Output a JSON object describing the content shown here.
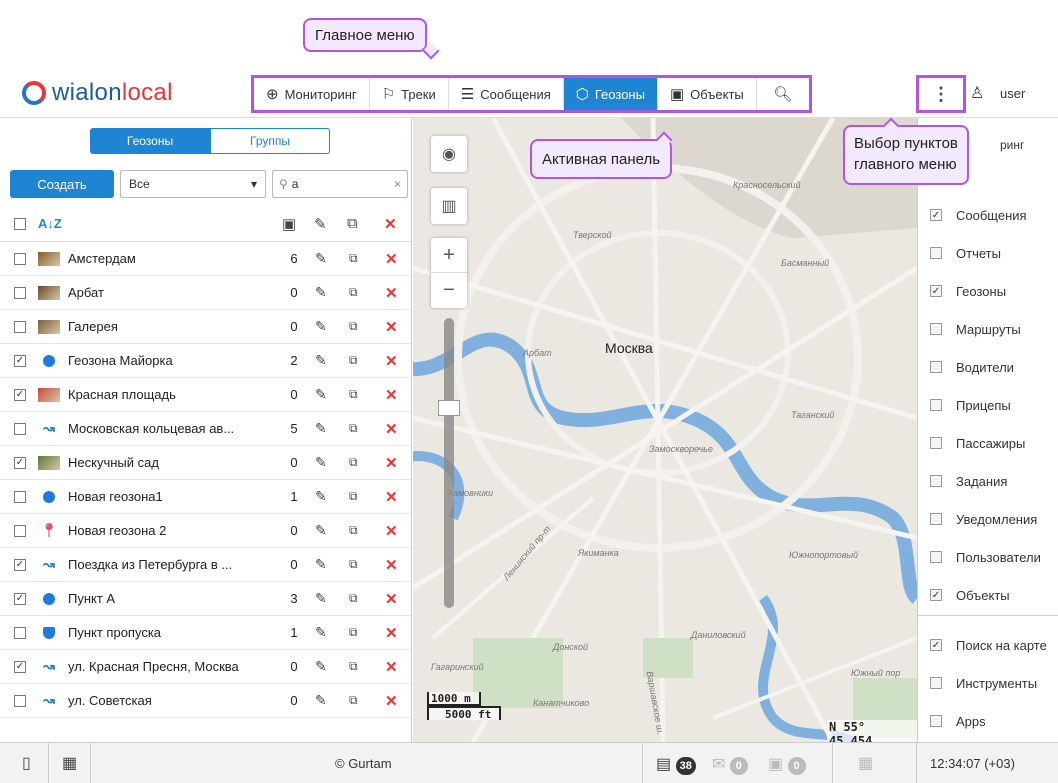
{
  "callouts": {
    "main_menu": "Главное меню",
    "active_panel": "Активная панель",
    "select_items_line1": "Выбор пунктов",
    "select_items_line2": "главного меню"
  },
  "header": {
    "logo_text_1": "wialon",
    "logo_text_2": "local",
    "menu": [
      {
        "label": "Мониторинг",
        "icon": "globe-icon"
      },
      {
        "label": "Треки",
        "icon": "track-flag-icon"
      },
      {
        "label": "Сообщения",
        "icon": "messages-icon"
      },
      {
        "label": "Геозоны",
        "icon": "geofence-icon",
        "active": true
      },
      {
        "label": "Объекты",
        "icon": "bus-icon"
      }
    ],
    "more_icon": "⋮",
    "user": "user"
  },
  "left": {
    "tabs": [
      "Геозоны",
      "Группы"
    ],
    "create_label": "Создать",
    "filter_value": "Все",
    "search_value": "а",
    "rows": [
      {
        "name": "Амстердам",
        "count": "6",
        "checked": false,
        "icon": "pic",
        "color": "#8a5a2b"
      },
      {
        "name": "Арбат",
        "count": "0",
        "checked": false,
        "icon": "pic",
        "color": "#6b4a2a"
      },
      {
        "name": "Галерея",
        "count": "0",
        "checked": false,
        "icon": "pic",
        "color": "#7a5d40"
      },
      {
        "name": "Геозона Майорка",
        "count": "2",
        "checked": true,
        "icon": "dot"
      },
      {
        "name": "Красная площадь",
        "count": "0",
        "checked": true,
        "icon": "pic",
        "color": "#c94a3a"
      },
      {
        "name": "Московская кольцевая ав...",
        "count": "5",
        "checked": false,
        "icon": "line"
      },
      {
        "name": "Нескучный сад",
        "count": "0",
        "checked": true,
        "icon": "pic",
        "color": "#5a7a3a"
      },
      {
        "name": "Новая геозона1",
        "count": "1",
        "checked": false,
        "icon": "dot"
      },
      {
        "name": "Новая геозона 2",
        "count": "0",
        "checked": false,
        "icon": "pin"
      },
      {
        "name": "Поездка из Петербурга в ...",
        "count": "0",
        "checked": true,
        "icon": "line"
      },
      {
        "name": "Пункт А",
        "count": "3",
        "checked": true,
        "icon": "dot"
      },
      {
        "name": "Пункт пропуска",
        "count": "1",
        "checked": false,
        "icon": "shield"
      },
      {
        "name": "ул. Красная Пресня, Москва",
        "count": "0",
        "checked": true,
        "icon": "line"
      },
      {
        "name": "ул. Советская",
        "count": "0",
        "checked": false,
        "icon": "line"
      }
    ]
  },
  "map": {
    "city": "Москва",
    "labels": [
      "Тверской",
      "Басманный",
      "Красносельский",
      "Арбат",
      "Таганский",
      "Замоскворечье",
      "Хамовники",
      "Ленинский пр-т",
      "Якиманка",
      "Даниловский",
      "Донской",
      "Гагаринский",
      "Южнопортовый",
      "Канатчиково",
      "Южный пор",
      "Варшавское ш."
    ],
    "scale_m": "1000 m",
    "scale_ft": "5000 ft",
    "coords": "N 55° 45.454"
  },
  "rpanel": {
    "partial_top": "ринг",
    "items": [
      {
        "label": "Сообщения",
        "checked": true
      },
      {
        "label": "Отчеты",
        "checked": false
      },
      {
        "label": "Геозоны",
        "checked": true
      },
      {
        "label": "Маршруты",
        "checked": false
      },
      {
        "label": "Водители",
        "checked": false
      },
      {
        "label": "Прицепы",
        "checked": false
      },
      {
        "label": "Пассажиры",
        "checked": false
      },
      {
        "label": "Задания",
        "checked": false
      },
      {
        "label": "Уведомления",
        "checked": false
      },
      {
        "label": "Пользователи",
        "checked": false
      },
      {
        "label": "Объекты",
        "checked": true
      },
      {
        "label": "Поиск на карте",
        "checked": true
      },
      {
        "label": "Инструменты",
        "checked": false
      },
      {
        "label": "Apps",
        "checked": false
      }
    ]
  },
  "footer": {
    "copyright": "© Gurtam",
    "msg_count": "38",
    "event_count": "0",
    "notify_count": "0",
    "time": "12:34:07 (+03)"
  }
}
